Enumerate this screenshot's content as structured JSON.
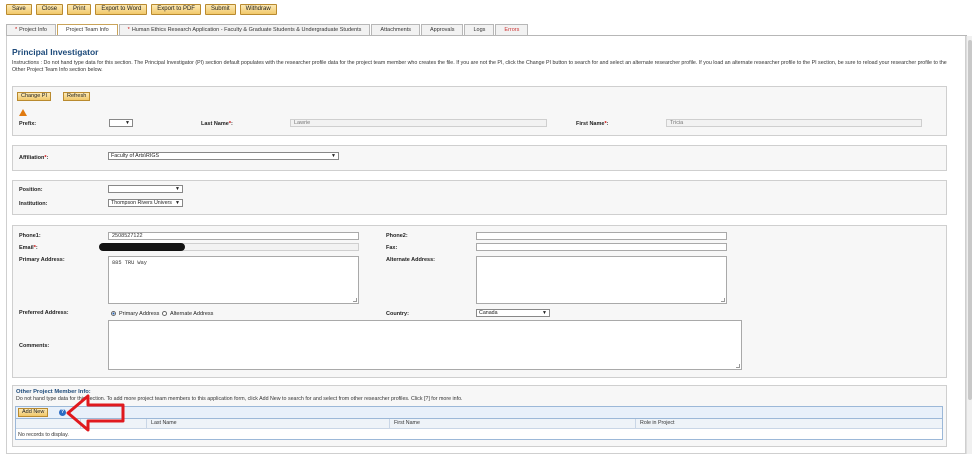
{
  "toolbar": {
    "buttons": [
      "Save",
      "Close",
      "Print",
      "Export to Word",
      "Export to PDF",
      "Submit",
      "Withdraw"
    ]
  },
  "tabs": [
    {
      "label": "Project Info",
      "required": true
    },
    {
      "label": "Project Team Info",
      "required": false,
      "active": true
    },
    {
      "label": "Human Ethics Research Application - Faculty & Graduate Students & Undergraduate Students",
      "required": true
    },
    {
      "label": "Attachments",
      "required": false
    },
    {
      "label": "Approvals",
      "required": false
    },
    {
      "label": "Logs",
      "required": false
    },
    {
      "label": "Errors",
      "required": false,
      "error": true
    }
  ],
  "pi": {
    "title": "Principal Investigator",
    "instructions": "Instructions : Do not hand type data for this section. The Principal Investigator (PI) section default populates with the researcher profile data for the project team member who creates the file. If you are not the PI, click the Change PI button to search for and select an alternate researcher profile. If you load an alternate researcher profile to the PI section, be sure to reload your researcher profile to the Other Project Team Info section below.",
    "change_pi_label": "Change PI",
    "refresh_label": "Refresh",
    "prefix_label": "Prefix:",
    "prefix_value": "",
    "last_name_label": "Last Name",
    "last_name_value": "Lawrie",
    "first_name_label": "First Name",
    "first_name_value": "Tricia",
    "required_mark": "*",
    "colon": ":",
    "affiliation_label": "Affiliation",
    "affiliation_value": "Faculty of Arts\\RIGS",
    "position_label": "Position:",
    "position_value": "",
    "institution_label": "Institution:",
    "institution_value": "Thompson Rivers Univers",
    "phone1_label": "Phone1:",
    "phone1_value": "2508527122",
    "phone2_label": "Phone2:",
    "phone2_value": "",
    "email_label": "Email",
    "fax_label": "Fax:",
    "fax_value": "",
    "primary_address_label": "Primary Address:",
    "primary_address_value": "885 TRU Way",
    "alternate_address_label": "Alternate Address:",
    "alternate_address_value": "",
    "preferred_address_label": "Preferred Address:",
    "preferred_primary_label": "Primary Address",
    "preferred_alternate_label": "Alternate Address",
    "preferred_selected": "Primary Address",
    "country_label": "Country:",
    "country_value": "Canada",
    "comments_label": "Comments:",
    "comments_value": ""
  },
  "other": {
    "title": "Other Project Member Info:",
    "note": "Do not hand type data for this section. To add more project team members to this application form, click Add New to search for and select from other researcher profiles. Click [?] for more info.",
    "add_new_label": "Add New",
    "help_symbol": "?",
    "columns": [
      "Last Name",
      "First Name",
      "Role in Project"
    ],
    "empty_text": "No records to display."
  },
  "colors": {
    "accent_button": "#f1c86a",
    "title_blue": "#1d4a7a",
    "arrow_red": "#e0191e",
    "required_red": "#cc0000"
  },
  "icons": {
    "warning": "warning-icon",
    "help": "help-icon",
    "arrow": "red-arrow-annotation"
  }
}
